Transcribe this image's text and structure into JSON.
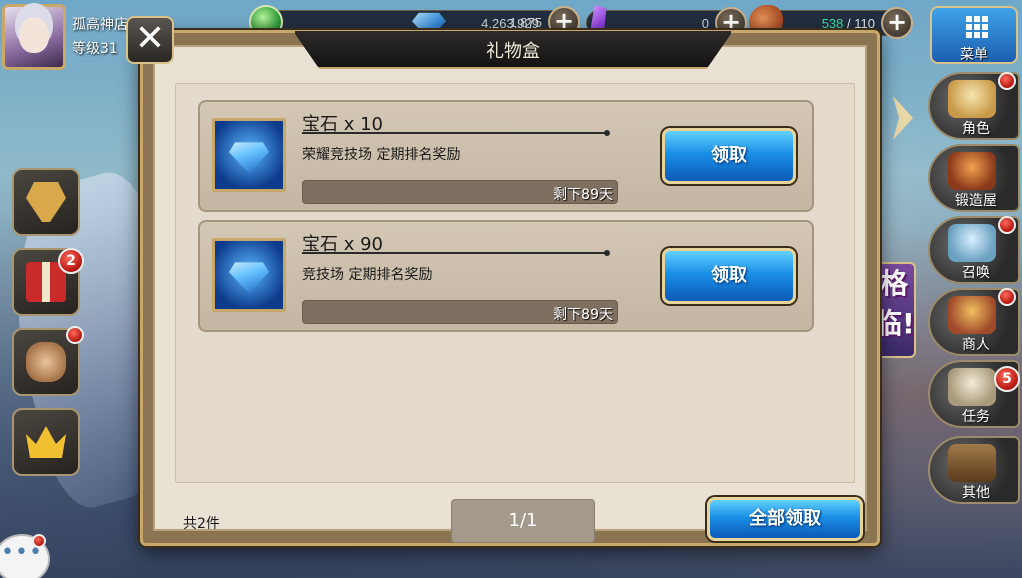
{
  "player": {
    "name": "孤高神店",
    "level_label": "等级31"
  },
  "resources": {
    "gold": "4,263,929",
    "gems": "1,875",
    "crystals": "0",
    "stamina_current": "538",
    "stamina_sep": "/",
    "stamina_max": "110",
    "plus_label": "+"
  },
  "menu": {
    "label": "菜单",
    "side_items": [
      {
        "label": "角色",
        "icon": "character-icon"
      },
      {
        "label": "锻造屋",
        "icon": "forge-icon"
      },
      {
        "label": "召唤",
        "icon": "summon-icon"
      },
      {
        "label": "商人",
        "icon": "merchant-icon"
      },
      {
        "label": "任务",
        "icon": "quest-icon",
        "badge": "5"
      },
      {
        "label": "其他",
        "icon": "door-icon"
      }
    ]
  },
  "left_icons": {
    "gift_badge": "2"
  },
  "event_banner": "格\n临!",
  "chat": "•••",
  "modal": {
    "title": "礼物盒",
    "close_label": "✕",
    "gifts": [
      {
        "name": "宝石 x 10",
        "desc": "荣耀竞技场 定期排名奖励",
        "remaining": "剩下89天",
        "claim_label": "领取"
      },
      {
        "name": "宝石 x 90",
        "desc": "竞技场 定期排名奖励",
        "remaining": "剩下89天",
        "claim_label": "领取"
      }
    ],
    "total_count": "共2件",
    "page_indicator": "1/1",
    "claim_all_label": "全部领取"
  },
  "colors": {
    "claim_button": "#1a8fe6",
    "stamina": "#37e3a0",
    "badge_red": "#b3160e"
  }
}
